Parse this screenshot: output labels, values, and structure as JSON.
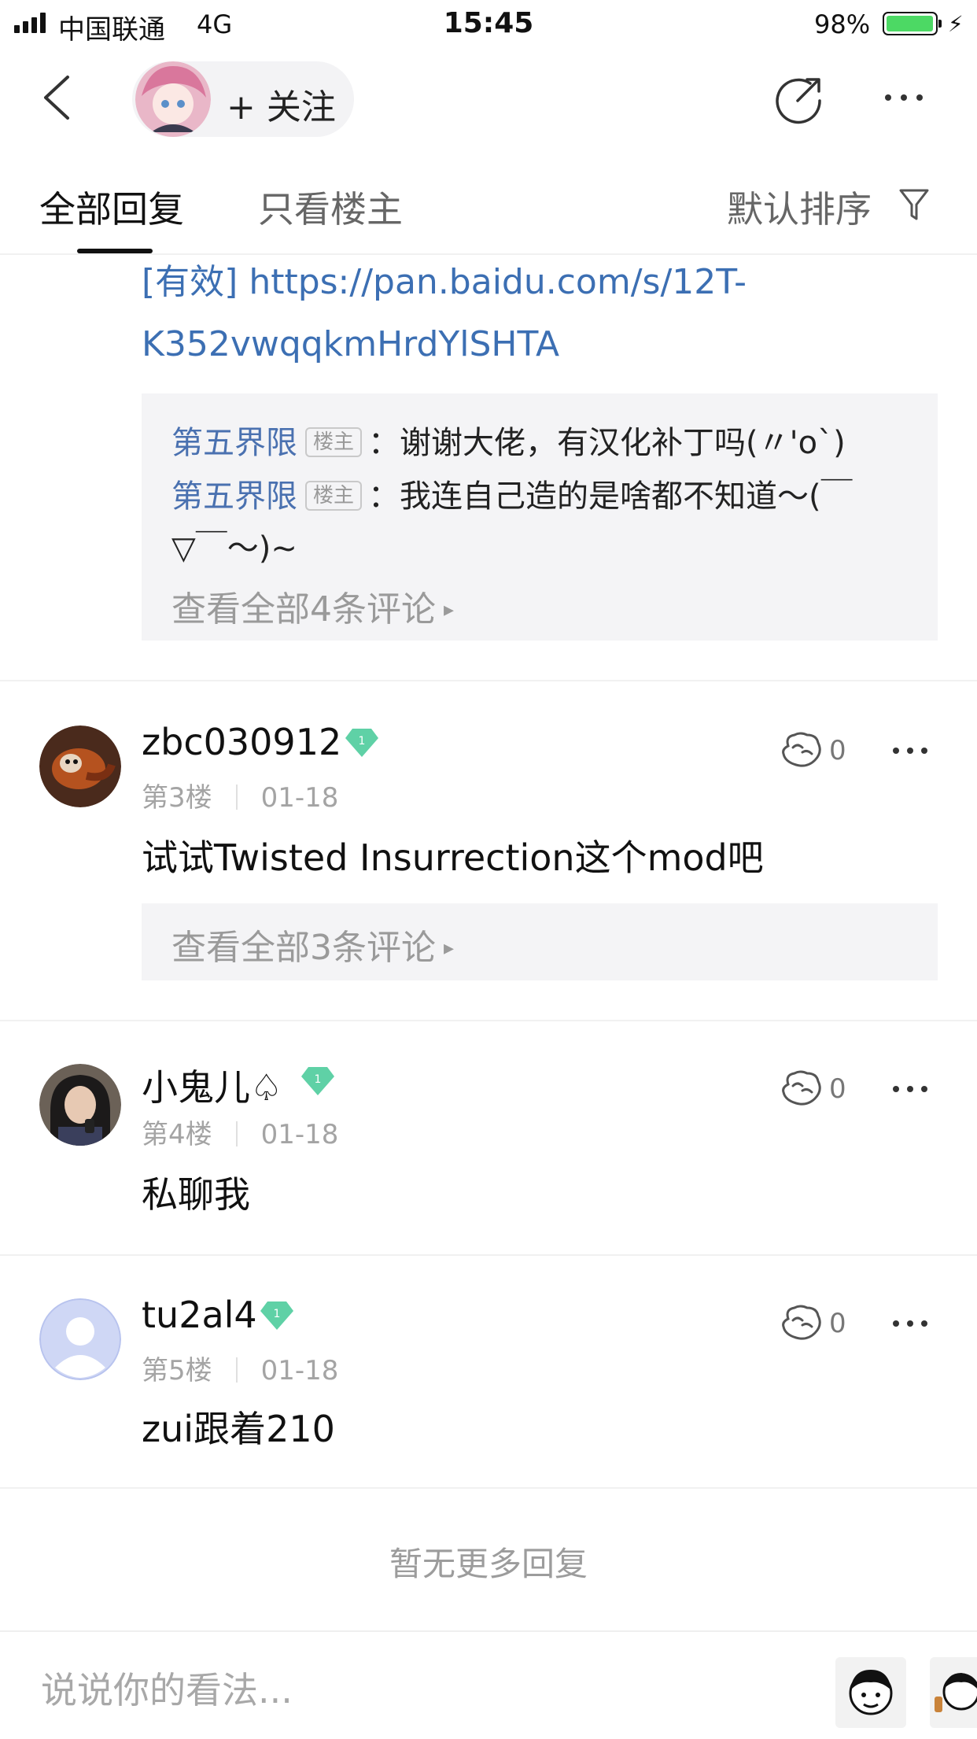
{
  "status_bar": {
    "carrier": "中国联通",
    "network": "4G",
    "time": "15:45",
    "battery": "98%",
    "battery_level": 0.98
  },
  "nav": {
    "follow_label": "+ 关注"
  },
  "tabs": {
    "all": "全部回复",
    "owner_only": "只看楼主",
    "sort": "默认排序"
  },
  "top_post": {
    "link_line1": "[有效] https://pan.baidu.com/s/12T-",
    "link_line2": "K352vwqqkmHrdYlSHTA",
    "comments": [
      {
        "name": "第五界限",
        "tag": "楼主",
        "sep": "：",
        "text": "谢谢大佬，有汉化补丁吗(〃'o`)"
      },
      {
        "name": "第五界限",
        "tag": "楼主",
        "sep": "：",
        "text": "我连自己造的是啥都不知道～(￣",
        "text_cont": "▽￣～)~"
      }
    ],
    "view_all": "查看全部4条评论"
  },
  "replies": [
    {
      "username": "zbc030912",
      "level": "1",
      "floor": "第3楼",
      "date": "01-18",
      "likes": "0",
      "content": "试试Twisted Insurrection这个mod吧",
      "view_all": "查看全部3条评论"
    },
    {
      "username": "小鬼儿♤",
      "level": "1",
      "floor": "第4楼",
      "date": "01-18",
      "likes": "0",
      "content": "私聊我"
    },
    {
      "username": "tu2al4",
      "level": "1",
      "floor": "第5楼",
      "date": "01-18",
      "likes": "0",
      "content": "zui跟着210"
    }
  ],
  "footer": {
    "no_more": "暂无更多回复",
    "input_placeholder": "说说你的看法..."
  },
  "colors": {
    "link": "#3c6fb3",
    "comment_name": "#4a71b0",
    "gem": "#5fd1a6",
    "panel": "#f4f4f6"
  }
}
